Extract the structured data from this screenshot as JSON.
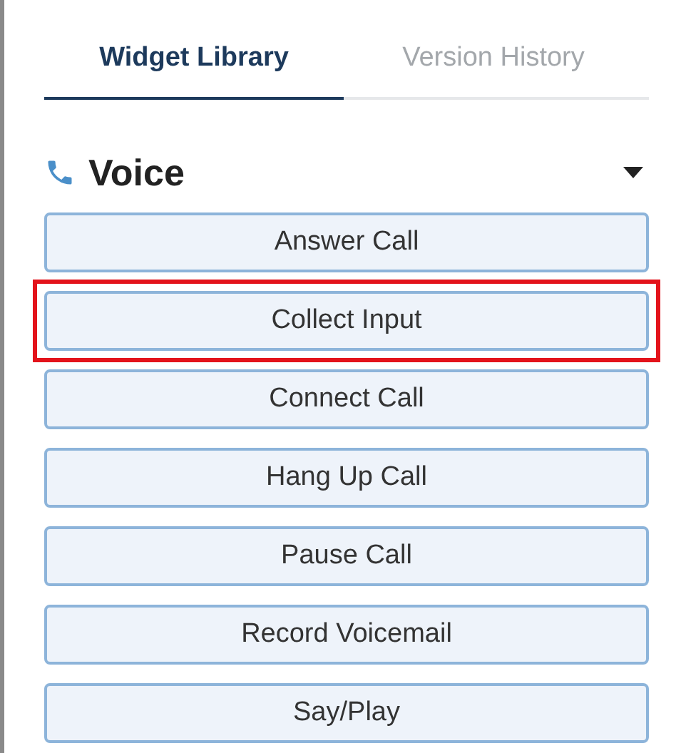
{
  "tabs": [
    {
      "label": "Widget Library",
      "selected": true
    },
    {
      "label": "Version History",
      "selected": false
    }
  ],
  "section": {
    "title": "Voice",
    "expanded": true
  },
  "widgets": [
    {
      "label": "Answer Call",
      "highlighted": false
    },
    {
      "label": "Collect Input",
      "highlighted": true
    },
    {
      "label": "Connect Call",
      "highlighted": false
    },
    {
      "label": "Hang Up Call",
      "highlighted": false
    },
    {
      "label": "Pause Call",
      "highlighted": false
    },
    {
      "label": "Record Voicemail",
      "highlighted": false
    },
    {
      "label": "Say/Play",
      "highlighted": false
    }
  ]
}
